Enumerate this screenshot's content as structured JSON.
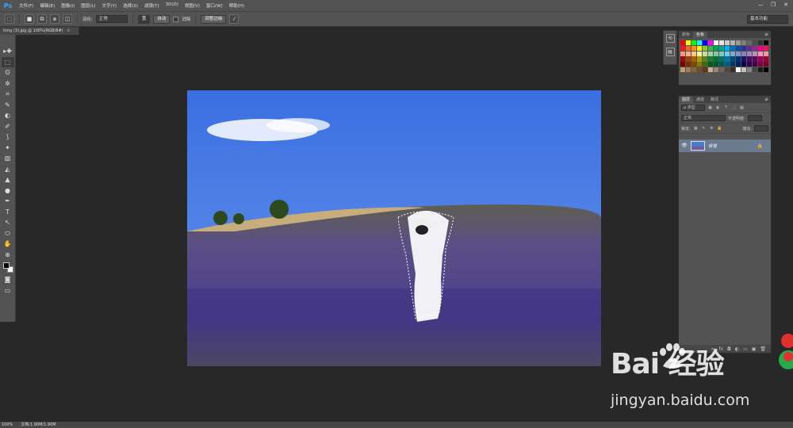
{
  "app": {
    "logo": "Ps"
  },
  "menu": [
    "文件(F)",
    "编辑(E)",
    "图像(I)",
    "图层(L)",
    "文字(Y)",
    "选择(S)",
    "滤镜(T)",
    "3D(D)",
    "视图(V)",
    "窗口(W)",
    "帮助(H)"
  ],
  "window_controls": {
    "minimize": "—",
    "restore": "❐",
    "close": "✕"
  },
  "options": {
    "feather_label": "羽化:",
    "feather_value": "正常",
    "btn_width": "宽",
    "btn_height": "自动",
    "anti_alias_label": "消除",
    "refine_edge": "调整边缘",
    "workspace": "基本功能"
  },
  "document": {
    "tab_title": "timg (3).jpg @ 100%(RGB/8#)",
    "close": "×"
  },
  "status": {
    "zoom": "100%",
    "doc_info": "文档:1.90M/1.90M"
  },
  "tools": [
    "▸✚",
    "⬚",
    "ʘ",
    "✲",
    "⌗",
    "✎",
    "◐",
    "✐",
    "⟆",
    "✦",
    "▥",
    "◭",
    "▲",
    "●",
    "✒",
    "T",
    "↖",
    "⬭",
    "✋",
    "⊕"
  ],
  "swatch_panel": {
    "tabs": [
      "颜色",
      "色板"
    ],
    "active_tab": 1,
    "colors": [
      "#ff0000",
      "#ffff00",
      "#00ff00",
      "#00ffff",
      "#0000ff",
      "#ff00ff",
      "#ffffff",
      "#e6e6e6",
      "#cccccc",
      "#b3b3b3",
      "#999999",
      "#808080",
      "#666666",
      "#4d4d4d",
      "#333333",
      "#000000",
      "#ed1c24",
      "#f26522",
      "#f7941d",
      "#fff200",
      "#8dc63f",
      "#39b54a",
      "#00a651",
      "#00a99d",
      "#00aeef",
      "#0072bc",
      "#0054a6",
      "#2e3192",
      "#662d91",
      "#92278f",
      "#ec008c",
      "#ed145b",
      "#f69679",
      "#f9ad81",
      "#fdc689",
      "#fff79a",
      "#c4df9b",
      "#a3d39c",
      "#82ca9c",
      "#7accc8",
      "#6dcff6",
      "#7da7d9",
      "#8393ca",
      "#8781bd",
      "#a186be",
      "#bd8cbf",
      "#f49ac1",
      "#f5989d",
      "#9e0b0f",
      "#a0410d",
      "#a36209",
      "#aba000",
      "#598527",
      "#1a7b30",
      "#007236",
      "#00746b",
      "#0076a3",
      "#004b80",
      "#003471",
      "#1b1464",
      "#440e62",
      "#630460",
      "#9e005d",
      "#9e0039",
      "#790000",
      "#7b2e00",
      "#7d4900",
      "#827b00",
      "#406618",
      "#005e20",
      "#005826",
      "#005952",
      "#005b7f",
      "#003663",
      "#002157",
      "#0d004c",
      "#32004b",
      "#4b0049",
      "#7b0046",
      "#7a0026",
      "#c69c6d",
      "#a67c52",
      "#8c6239",
      "#754c24",
      "#603913",
      "#c7b299",
      "#998675",
      "#736357",
      "#534741",
      "#37302a",
      "#ffffff",
      "#c2c2c2",
      "#858585",
      "#474747",
      "#1a1a1a",
      "#000000"
    ]
  },
  "layers_panel": {
    "tabs": [
      "图层",
      "通道",
      "路径"
    ],
    "active_tab": 0,
    "filter_label": "ρ 类型",
    "blend_mode": "正常",
    "opacity_label": "不透明度:",
    "lock_label": "锁定:",
    "fill_label": "填充:",
    "layer": {
      "name": "背景",
      "visible_icon": "👁",
      "lock": "🔒"
    }
  },
  "watermark": {
    "logo": "Bai  经验",
    "url": "jingyan.baidu.com"
  }
}
